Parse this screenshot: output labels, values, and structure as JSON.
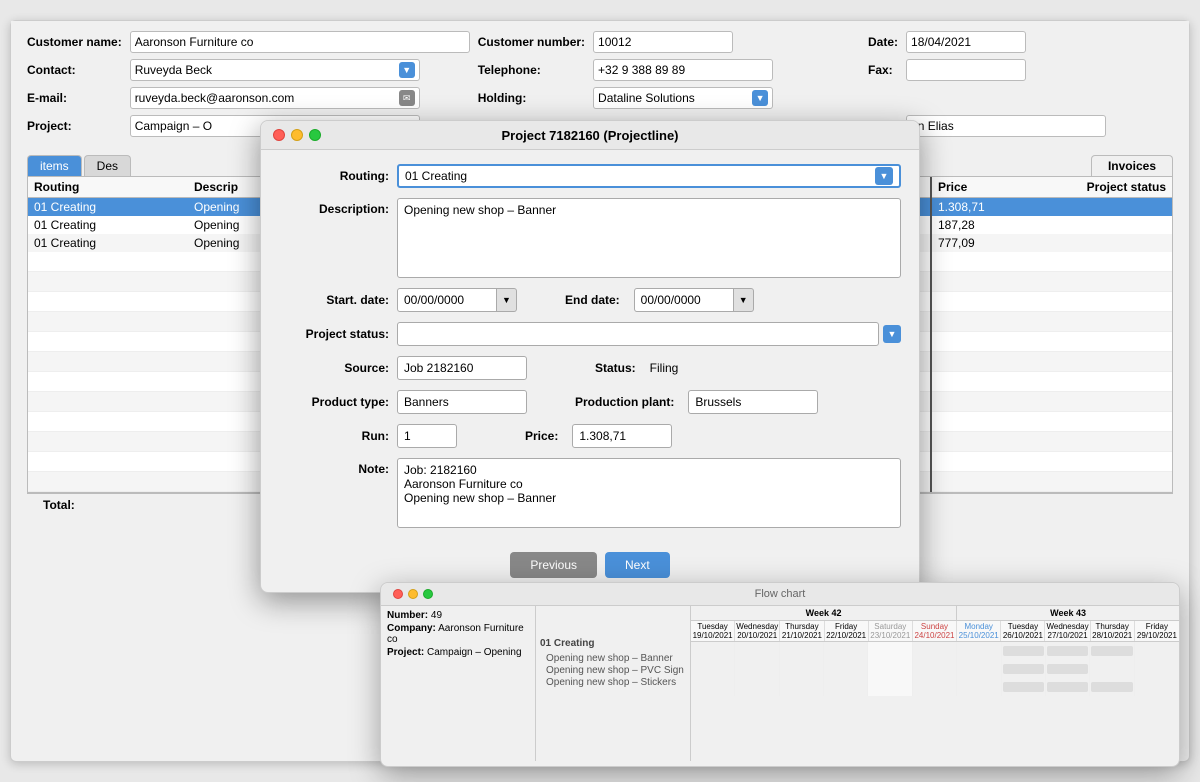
{
  "main_window": {
    "customer_name_label": "Customer name:",
    "customer_name_value": "Aaronson Furniture co",
    "contact_label": "Contact:",
    "contact_value": "Ruveyda Beck",
    "email_label": "E-mail:",
    "email_value": "ruveyda.beck@aaronson.com",
    "project_label": "Project:",
    "project_value": "Campaign – O",
    "customer_number_label": "Customer number:",
    "customer_number_value": "10012",
    "telephone_label": "Telephone:",
    "telephone_value": "+32 9 388 89 89",
    "fax_label": "Fax:",
    "fax_value": "",
    "date_label": "Date:",
    "date_value": "18/04/2021",
    "holding_label": "Holding:",
    "holding_value": "Dataline Solutions",
    "contact_right_value": "an Elias"
  },
  "tabs": {
    "items_label": "items",
    "desc_label": "Des",
    "invoices_label": "Invoices"
  },
  "table": {
    "col_routing": "Routing",
    "col_desc": "Descrip",
    "rows": [
      {
        "routing": "01 Creating",
        "desc": "Opening",
        "selected": true
      },
      {
        "routing": "01 Creating",
        "desc": "Opening",
        "selected": false
      },
      {
        "routing": "01 Creating",
        "desc": "Opening",
        "selected": false
      }
    ],
    "price_col": "Price",
    "status_col": "Project status",
    "price_rows": [
      {
        "price": "1.308,71",
        "status": ""
      },
      {
        "price": "187,28",
        "status": ""
      },
      {
        "price": "777,09",
        "status": ""
      }
    ],
    "total_label": "Total:"
  },
  "modal": {
    "title": "Project 7182160 (Projectline)",
    "routing_label": "Routing:",
    "routing_value": "01 Creating",
    "description_label": "Description:",
    "description_value": "Opening new shop – Banner",
    "start_date_label": "Start. date:",
    "start_date_value": "00/00/0000",
    "end_date_label": "End date:",
    "end_date_value": "00/00/0000",
    "project_status_label": "Project status:",
    "source_label": "Source:",
    "source_value": "Job 2182160",
    "status_label": "Status:",
    "status_value": "Filing",
    "product_type_label": "Product type:",
    "product_type_value": "Banners",
    "production_plant_label": "Production plant:",
    "production_plant_value": "Brussels",
    "run_label": "Run:",
    "run_value": "1",
    "price_label": "Price:",
    "price_value": "1.308,71",
    "note_label": "Note:",
    "note_value": "Job: 2182160\nAaronson Furniture co\nOpening new shop – Banner",
    "btn_previous": "Previous",
    "btn_next": "Next"
  },
  "flowchart": {
    "title": "Flow chart",
    "number_label": "Number:",
    "number_value": "49",
    "company_label": "Company:",
    "company_value": "Aaronson Furniture co",
    "project_label": "Project:",
    "project_value": "Campaign – Opening",
    "week42_label": "Week 42",
    "week43_label": "Week 43",
    "days": [
      {
        "name": "Tuesday",
        "date": "19/10/2021",
        "type": "normal"
      },
      {
        "name": "Wednesday",
        "date": "20/10/2021",
        "type": "normal"
      },
      {
        "name": "Thursday",
        "date": "21/10/2021",
        "type": "normal"
      },
      {
        "name": "Friday",
        "date": "22/10/2021",
        "type": "normal"
      },
      {
        "name": "Saturday",
        "date": "23/10/2021",
        "type": "saturday"
      },
      {
        "name": "Sunday",
        "date": "24/10/2021",
        "type": "sunday"
      },
      {
        "name": "Monday",
        "date": "25/10/2021",
        "type": "monday"
      },
      {
        "name": "Tuesday",
        "date": "26/10/2021",
        "type": "normal"
      },
      {
        "name": "Wednesday",
        "date": "27/10/2021",
        "type": "normal"
      },
      {
        "name": "Thursday",
        "date": "28/10/2021",
        "type": "normal"
      },
      {
        "name": "Friday",
        "date": "29/10/2021",
        "type": "normal"
      }
    ],
    "task_group": "01 Creating",
    "tasks": [
      "Opening new shop – Banner",
      "Opening new shop – PVC Sign",
      "Opening new shop – Stickers"
    ]
  }
}
